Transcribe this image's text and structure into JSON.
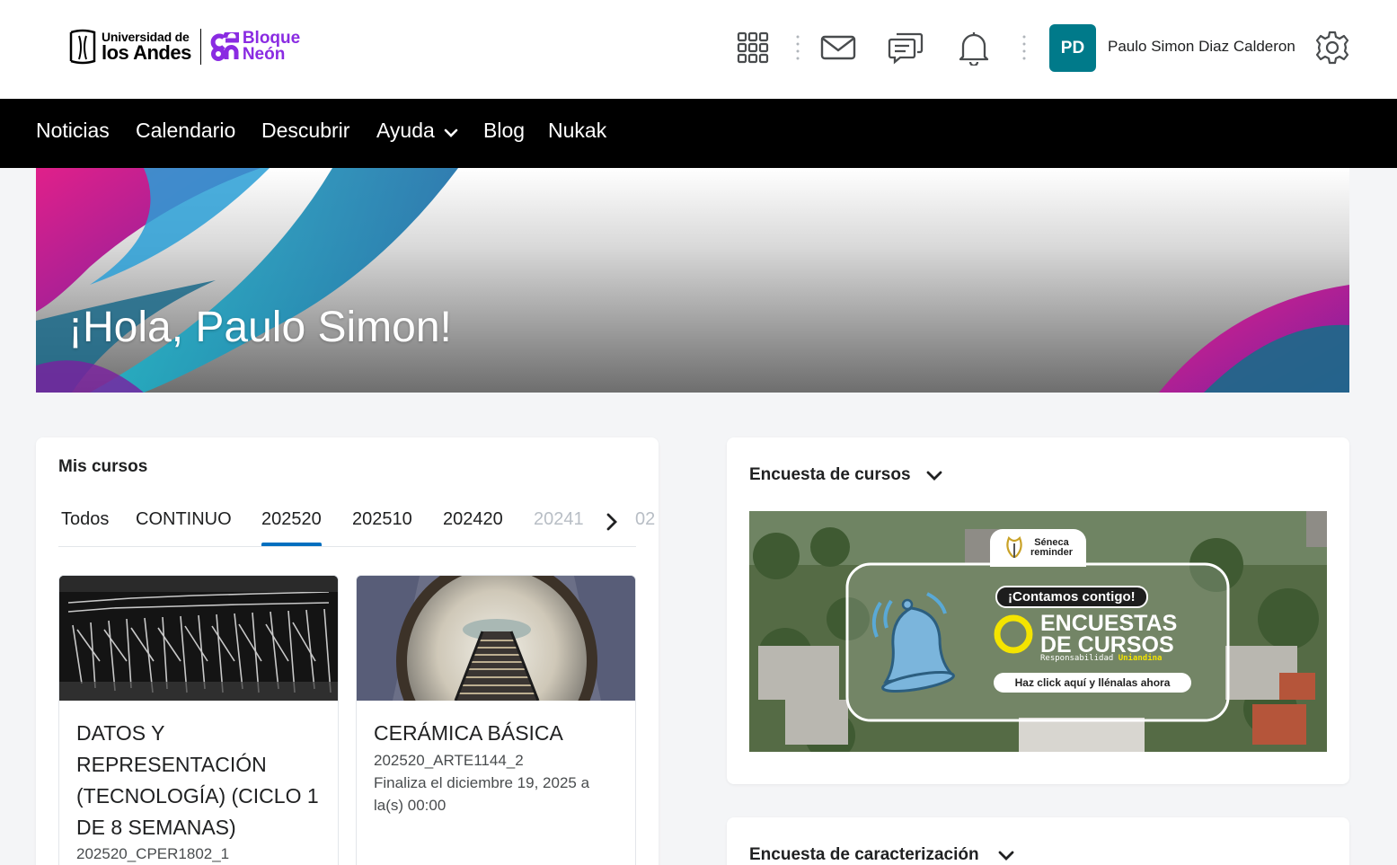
{
  "header": {
    "university_line1": "Universidad de",
    "university_line2": "los Andes",
    "brand_line1": "Bloque",
    "brand_line2": "Neón",
    "avatar_initials": "PD",
    "user_name": "Paulo Simon Diaz Calderon",
    "icons": [
      "apps-grid-icon",
      "mail-icon",
      "chat-icon",
      "bell-icon",
      "gear-icon"
    ]
  },
  "nav": {
    "items": [
      "Noticias",
      "Calendario",
      "Descubrir",
      "Ayuda",
      "Blog",
      "Nukak"
    ]
  },
  "hero": {
    "greeting": "¡Hola, Paulo Simon!"
  },
  "my_courses": {
    "title": "Mis cursos",
    "tabs": [
      "Todos",
      "CONTINUO",
      "202520",
      "202510",
      "202420",
      "20241",
      "02"
    ],
    "active_tab": "202520",
    "courses": [
      {
        "name": "DATOS Y REPRESENTACIÓN (TECNOLOGÍA) (CICLO 1 DE 8 SEMANAS)",
        "code": "202520_CPER1802_1"
      },
      {
        "name": "CERÁMICA BÁSICA",
        "code": "202520_ARTE1144_2",
        "end": "Finaliza el diciembre 19, 2025 a la(s) 00:00"
      }
    ]
  },
  "survey_widget": {
    "title": "Encuesta de cursos",
    "banner": {
      "badge_line1": "Séneca",
      "badge_line2": "reminder",
      "pill": "¡Contamos contigo!",
      "headline_line1": "ENCUESTAS",
      "headline_line2": "DE CURSOS",
      "sub": "Responsabilidad",
      "sub_accent": "Uniandina",
      "cta": "Haz click aquí y llénalas ahora"
    }
  },
  "characterization_widget": {
    "title": "Encuesta de caracterización"
  },
  "colors": {
    "accent_blue": "#006fbf",
    "avatar_teal": "#007a8a",
    "brand_purple": "#8a2be2",
    "nav_black": "#000000"
  }
}
